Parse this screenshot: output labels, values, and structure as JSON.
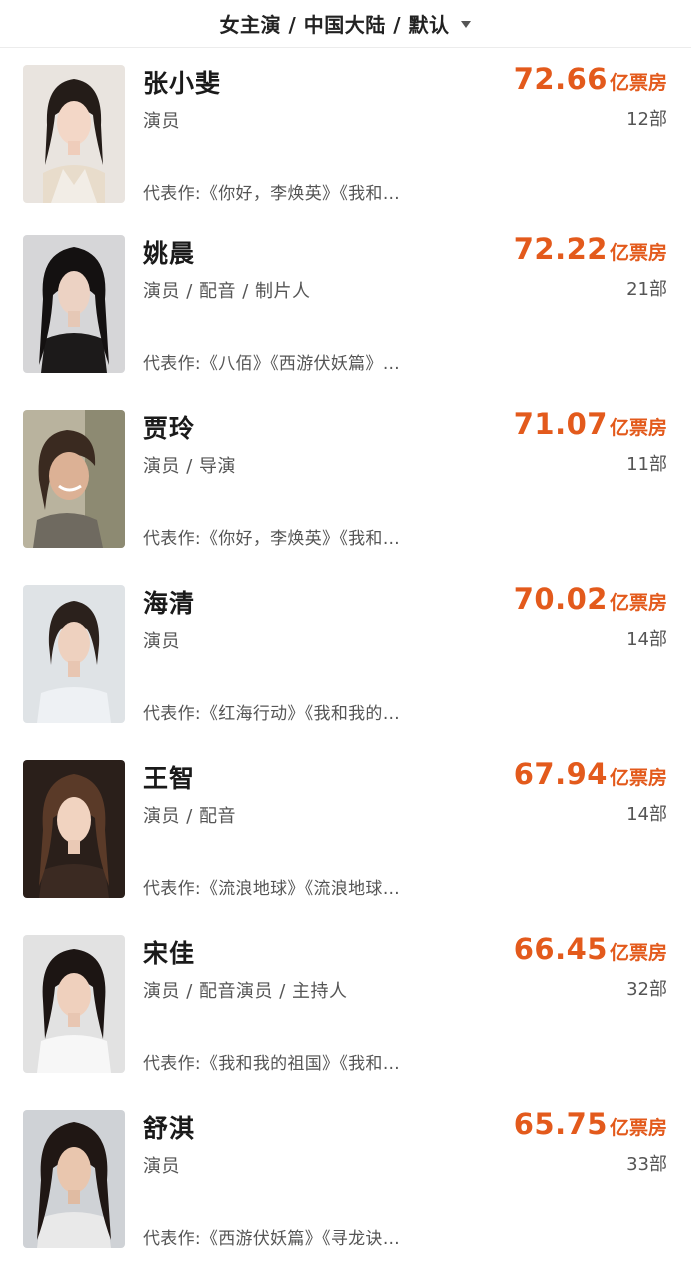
{
  "filter": {
    "label": "女主演 / 中国大陆 / 默认",
    "caret_icon": "caret-down-icon"
  },
  "colors": {
    "accent": "#e35a1c",
    "text_primary": "#1a1a1a",
    "text_secondary": "#555555"
  },
  "actors": [
    {
      "name": "张小斐",
      "roles": "演员",
      "works": "代表作:《你好，李焕英》《我和…",
      "box_office": "72.66",
      "unit": "亿票房",
      "count": "12部"
    },
    {
      "name": "姚晨",
      "roles": "演员 / 配音 / 制片人",
      "works": "代表作:《八佰》《西游伏妖篇》…",
      "box_office": "72.22",
      "unit": "亿票房",
      "count": "21部"
    },
    {
      "name": "贾玲",
      "roles": "演员 / 导演",
      "works": "代表作:《你好，李焕英》《我和…",
      "box_office": "71.07",
      "unit": "亿票房",
      "count": "11部"
    },
    {
      "name": "海清",
      "roles": "演员",
      "works": "代表作:《红海行动》《我和我的…",
      "box_office": "70.02",
      "unit": "亿票房",
      "count": "14部"
    },
    {
      "name": "王智",
      "roles": "演员 / 配音",
      "works": "代表作:《流浪地球》《流浪地球…",
      "box_office": "67.94",
      "unit": "亿票房",
      "count": "14部"
    },
    {
      "name": "宋佳",
      "roles": "演员 / 配音演员 / 主持人",
      "works": "代表作:《我和我的祖国》《我和…",
      "box_office": "66.45",
      "unit": "亿票房",
      "count": "32部"
    },
    {
      "name": "舒淇",
      "roles": "演员",
      "works": "代表作:《西游伏妖篇》《寻龙诀…",
      "box_office": "65.75",
      "unit": "亿票房",
      "count": "33部"
    }
  ]
}
